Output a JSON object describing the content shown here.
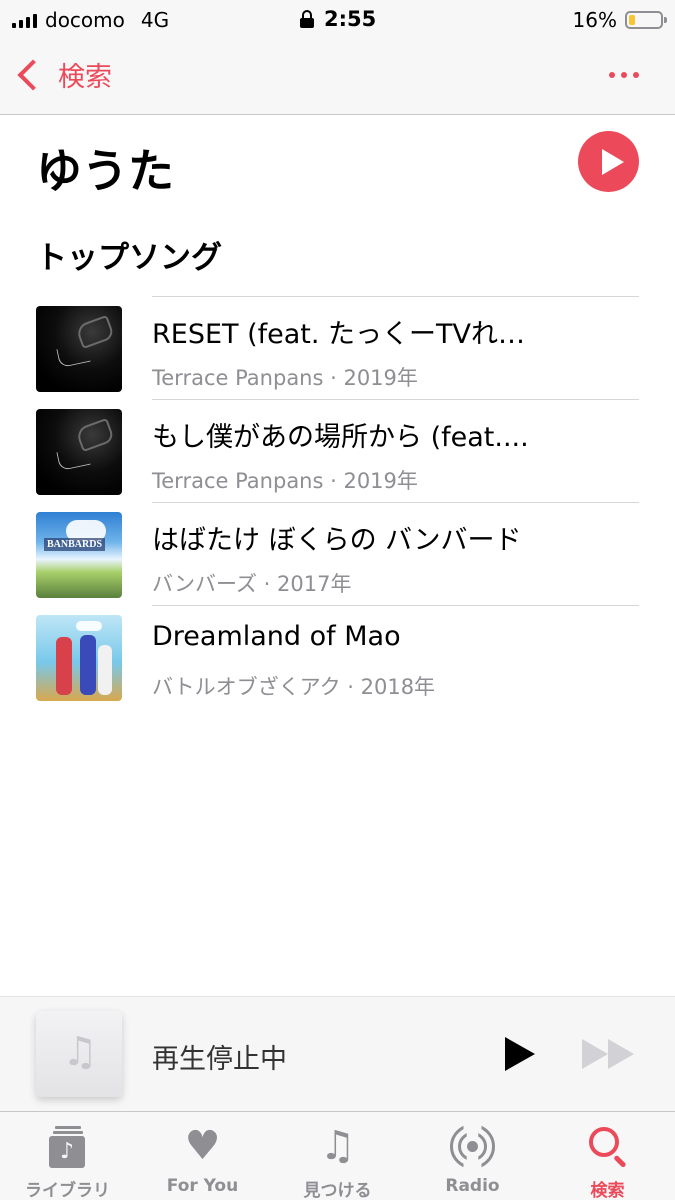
{
  "status_bar": {
    "carrier": "docomo",
    "network": "4G",
    "time": "2:55",
    "battery": "16%",
    "battery_level": 0.16
  },
  "nav": {
    "back_label": "検索"
  },
  "artist": {
    "name": "ゆうた"
  },
  "top_songs": {
    "heading": "トップソング",
    "items": [
      {
        "title": "RESET (feat. たっくーTVれ…",
        "subtitle": "Terrace Panpans · 2019年"
      },
      {
        "title": "もし僕があの場所から (feat....",
        "subtitle": "Terrace Panpans · 2019年"
      },
      {
        "title": "はばたけ ぼくらの バンバード",
        "subtitle": "バンバーズ · 2017年"
      },
      {
        "title": "Dreamland of Mao",
        "subtitle": "バトルオブざくアク · 2018年"
      }
    ]
  },
  "album_art": {
    "banbards_logo": "BANBARDS"
  },
  "mini_player": {
    "status": "再生停止中"
  },
  "tab_bar": {
    "tabs": [
      {
        "label": "ライブラリ",
        "icon": "library-icon"
      },
      {
        "label": "For You",
        "icon": "heart-icon"
      },
      {
        "label": "見つける",
        "icon": "music-note-icon"
      },
      {
        "label": "Radio",
        "icon": "radio-icon"
      },
      {
        "label": "検索",
        "icon": "search-icon",
        "active": true
      }
    ]
  },
  "colors": {
    "accent": "#ec4a5a",
    "secondary_text": "#8e8e93"
  }
}
